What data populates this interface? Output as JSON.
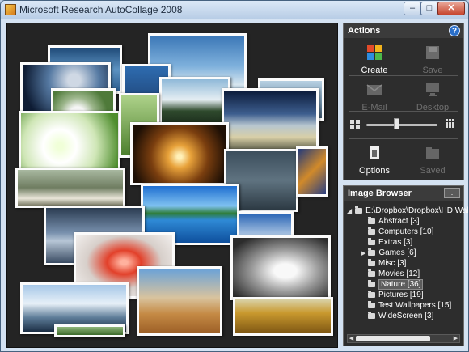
{
  "window": {
    "title": "Microsoft Research AutoCollage 2008"
  },
  "actions": {
    "header": "Actions",
    "create": "Create",
    "save": "Save",
    "email": "E-Mail",
    "desktop": "Desktop",
    "options": "Options",
    "saved": "Saved",
    "size_slider_value": 0.42
  },
  "browser": {
    "header": "Image Browser",
    "more_label": "...",
    "root": "E:\\Dropbox\\Dropbox\\HD Wal",
    "folders": [
      {
        "label": "Abstract [3]"
      },
      {
        "label": "Computers [10]"
      },
      {
        "label": "Extras [3]"
      },
      {
        "label": "Games [6]"
      },
      {
        "label": "Misc [3]"
      },
      {
        "label": "Movies [12]"
      },
      {
        "label": "Nature [36]"
      },
      {
        "label": "Pictures [19]"
      },
      {
        "label": "Test Wallpapers [15]"
      },
      {
        "label": "WideScreen [3]"
      }
    ],
    "selected": "Nature [36]"
  },
  "colors": {
    "accent": "#2a6fc9",
    "panel_bg": "#2d2d2d",
    "canvas_bg": "#242424"
  }
}
